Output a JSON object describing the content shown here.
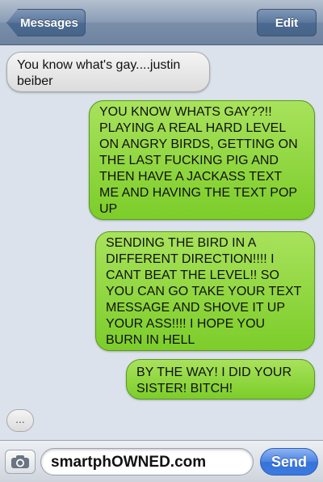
{
  "navbar": {
    "back_label": "Messages",
    "edit_label": "Edit"
  },
  "messages": [
    {
      "type": "received",
      "text": "You know what's gay....justin beiber"
    },
    {
      "type": "sent",
      "text": "YOU KNOW WHATS GAY??!! PLAYING A REAL HARD LEVEL ON ANGRY BIRDS, GETTING ON THE LAST FUCKING PIG AND THEN HAVE A JACKASS TEXT ME AND HAVING THE TEXT POP UP"
    },
    {
      "type": "sent",
      "text": "SENDING THE BIRD IN A DIFFERENT DIRECTION!!!! I CANT BEAT THE LEVEL!! SO YOU CAN GO TAKE YOUR TEXT MESSAGE AND SHOVE IT UP YOUR ASS!!!! I HOPE YOU BURN IN HELL"
    },
    {
      "type": "sent",
      "text": "BY THE WAY! I DID YOUR SISTER! BITCH!"
    }
  ],
  "typing_indicator": "...",
  "composer": {
    "value": "smartphOWNED.com",
    "send_label": "Send",
    "camera_icon": "camera-icon"
  },
  "colors": {
    "sent_bubble": "#7ccd2a",
    "received_bubble": "#e6e6e6",
    "send_button": "#3b7be0",
    "nav_bar": "#7a8fa9"
  }
}
